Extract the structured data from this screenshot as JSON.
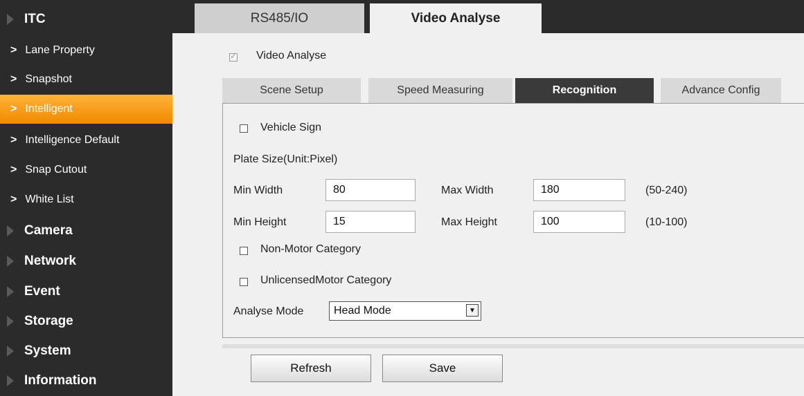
{
  "sidebar": {
    "itc_label": "ITC",
    "items": [
      {
        "label": "Lane Property"
      },
      {
        "label": "Snapshot"
      },
      {
        "label": "Intelligent"
      },
      {
        "label": "Intelligence Default"
      },
      {
        "label": "Snap Cutout"
      },
      {
        "label": "White List"
      }
    ],
    "groups": [
      {
        "label": "Camera"
      },
      {
        "label": "Network"
      },
      {
        "label": "Event"
      },
      {
        "label": "Storage"
      },
      {
        "label": "System"
      },
      {
        "label": "Information"
      }
    ]
  },
  "top_tabs": [
    {
      "label": "RS485/IO"
    },
    {
      "label": "Video Analyse"
    }
  ],
  "video_analyse": {
    "label": "Video Analyse",
    "checked": true
  },
  "sub_tabs": [
    {
      "label": "Scene Setup"
    },
    {
      "label": "Speed Measuring"
    },
    {
      "label": "Recognition"
    },
    {
      "label": "Advance Config"
    }
  ],
  "recognition": {
    "vehicle_sign_label": "Vehicle Sign",
    "plate_size_label": "Plate Size(Unit:Pixel)",
    "min_width_label": "Min Width",
    "min_width_value": "80",
    "max_width_label": "Max Width",
    "max_width_value": "180",
    "width_range": "(50-240)",
    "min_height_label": "Min Height",
    "min_height_value": "15",
    "max_height_label": "Max Height",
    "max_height_value": "100",
    "height_range": "(10-100)",
    "non_motor_label": "Non-Motor Category",
    "unlicensed_motor_label": "UnlicensedMotor Category",
    "analyse_mode_label": "Analyse Mode",
    "analyse_mode_value": "Head Mode"
  },
  "buttons": {
    "refresh": "Refresh",
    "save": "Save"
  },
  "colors": {
    "sidebar_bg": "#2b2b2b",
    "active_item": "#f59a10",
    "active_tab": "#3a3a3a"
  }
}
